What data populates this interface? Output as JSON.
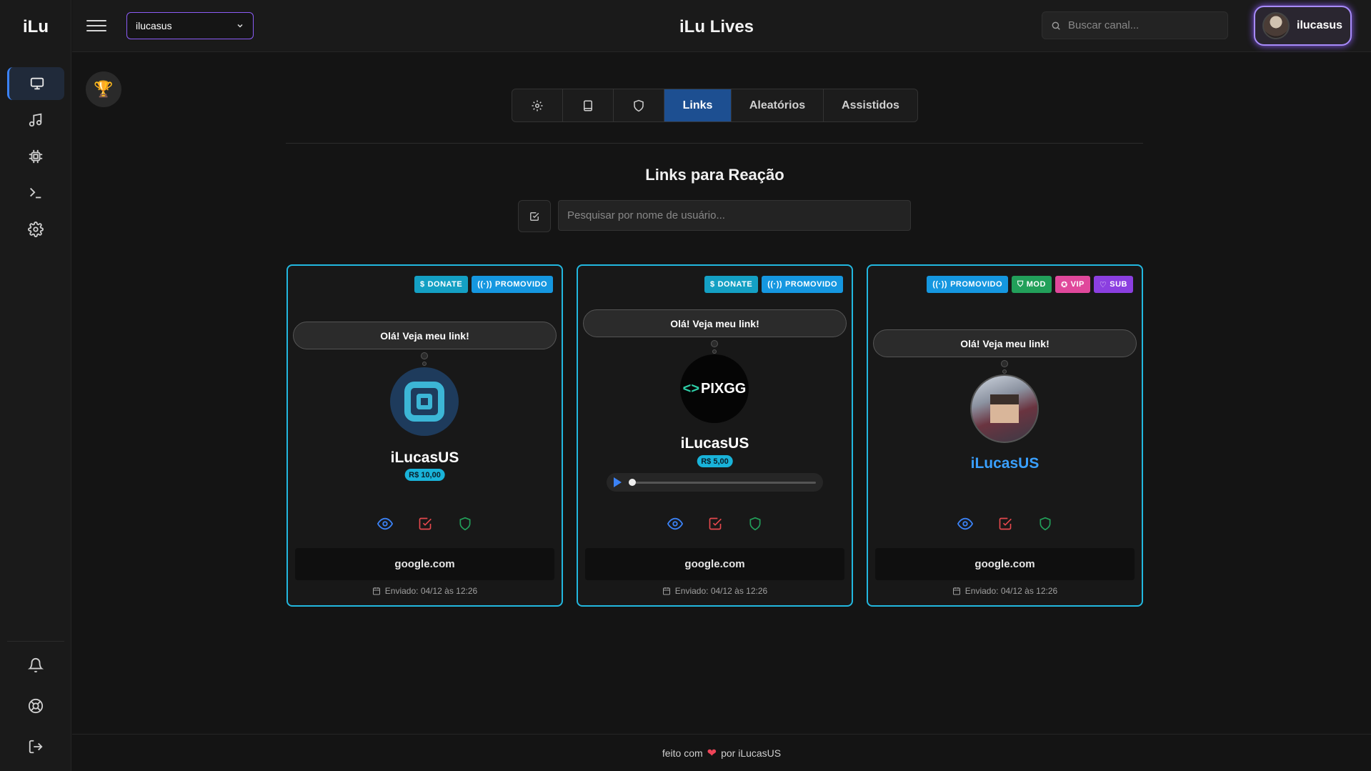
{
  "app": {
    "logo": "iLu",
    "title": "iLu Lives"
  },
  "header": {
    "channel_selected": "ilucasus",
    "search_placeholder": "Buscar canal...",
    "user_name": "ilucasus"
  },
  "tabs": [
    {
      "type": "icon",
      "icon": "gear-icon"
    },
    {
      "type": "icon",
      "icon": "book-icon"
    },
    {
      "type": "icon",
      "icon": "shield-icon"
    },
    {
      "label": "Links",
      "active": true
    },
    {
      "label": "Aleatórios"
    },
    {
      "label": "Assistidos"
    }
  ],
  "section": {
    "title": "Links para Reação",
    "search_placeholder": "Pesquisar por nome de usuário..."
  },
  "badges": {
    "donate": "DONATE",
    "promoted": "PROMOVIDO",
    "mod": "MOD",
    "vip": "VIP",
    "sub": "SUB"
  },
  "cards": [
    {
      "message": "Olá! Veja meu link!",
      "username": "iLucasUS",
      "amount": "R$ 10,00",
      "url": "google.com",
      "sent": "Enviado: 04/12 às 12:26"
    },
    {
      "message": "Olá! Veja meu link!",
      "username": "iLucasUS",
      "amount": "R$ 5,00",
      "avatar_text": "PIXGG",
      "url": "google.com",
      "sent": "Enviado: 04/12 às 12:26",
      "audio_progress": 0
    },
    {
      "message": "Olá! Veja meu link!",
      "username": "iLucasUS",
      "url": "google.com",
      "sent": "Enviado: 04/12 às 12:26"
    }
  ],
  "footer": {
    "before": "feito com",
    "after": "por iLucasUS"
  },
  "colors": {
    "accent": "#3b82f6",
    "card_border": "#22b8e0",
    "user_chip_border": "#a78bfa"
  }
}
